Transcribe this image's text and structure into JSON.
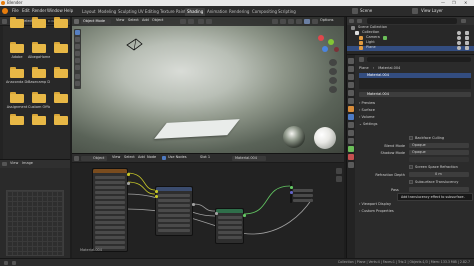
{
  "window": {
    "title": "Blender",
    "controls": [
      "—",
      "❐",
      "✕"
    ]
  },
  "menu": [
    "File",
    "Edit",
    "Render",
    "Window",
    "Help"
  ],
  "workspaces": [
    "Layout",
    "Modeling",
    "Sculpting",
    "UV Editing",
    "Texture Paint",
    "Shading",
    "Animation",
    "Rendering",
    "Compositing",
    "Scripting"
  ],
  "active_workspace": "Shading",
  "scene": {
    "label": "Scene",
    "view_layer": "View Layer"
  },
  "file_browser": {
    "header": {
      "view": "View",
      "select": "Select",
      "path": "C:\\Users\\..."
    },
    "folders": [
      "",
      "",
      "",
      "Adobe",
      "AlbegaHome",
      "",
      "Anaconda Dr...",
      "Basecamp D...",
      "",
      "Assignment",
      "Custom Offic...",
      "",
      "",
      "",
      ""
    ]
  },
  "image_editor": {
    "header": {
      "view": "View",
      "image": "Image"
    }
  },
  "viewport": {
    "header": {
      "mode": "Object Mode",
      "view": "View",
      "select": "Select",
      "add": "Add",
      "object": "Object",
      "options": "Options"
    }
  },
  "node_editor": {
    "header": {
      "type": "Object",
      "view": "View",
      "select": "Select",
      "add": "Add",
      "node": "Node",
      "use_nodes": "Use Nodes",
      "slot": "Slot 1",
      "material": "Material.004"
    },
    "label": "Material.004"
  },
  "outliner": {
    "title": "Scene Collection",
    "rows": [
      "Scene Collection",
      "Collection",
      "Camera",
      "Light",
      "Plane"
    ]
  },
  "properties": {
    "breadcrumb": [
      "Plane",
      "Material.004"
    ],
    "slot": "Material.004",
    "material": "Material.004",
    "sections": [
      "Preview",
      "Surface",
      "Volume",
      "Settings"
    ],
    "backface_culling": "Backface Culling",
    "blend_mode_label": "Blend Mode",
    "blend_mode": "Opaque",
    "shadow_mode_label": "Shadow Mode",
    "shadow_mode": "Opaque",
    "screen_space_refraction": "Screen Space Refraction",
    "refraction_depth_label": "Refraction Depth",
    "refraction_depth": "0 m",
    "subsurface_translucency": "Subsurface Translucency",
    "pass_index_label": "Pass",
    "tooltip": "Add translucency effect to subsurface.",
    "viewport_display": "Viewport Display",
    "custom_properties": "Custom Properties"
  },
  "status_bar": "Collection | Plane | Verts:4 | Faces:1 | Tris:2 | Objects:1/3 | Mem: 133.3 MiB | 2.82.7"
}
